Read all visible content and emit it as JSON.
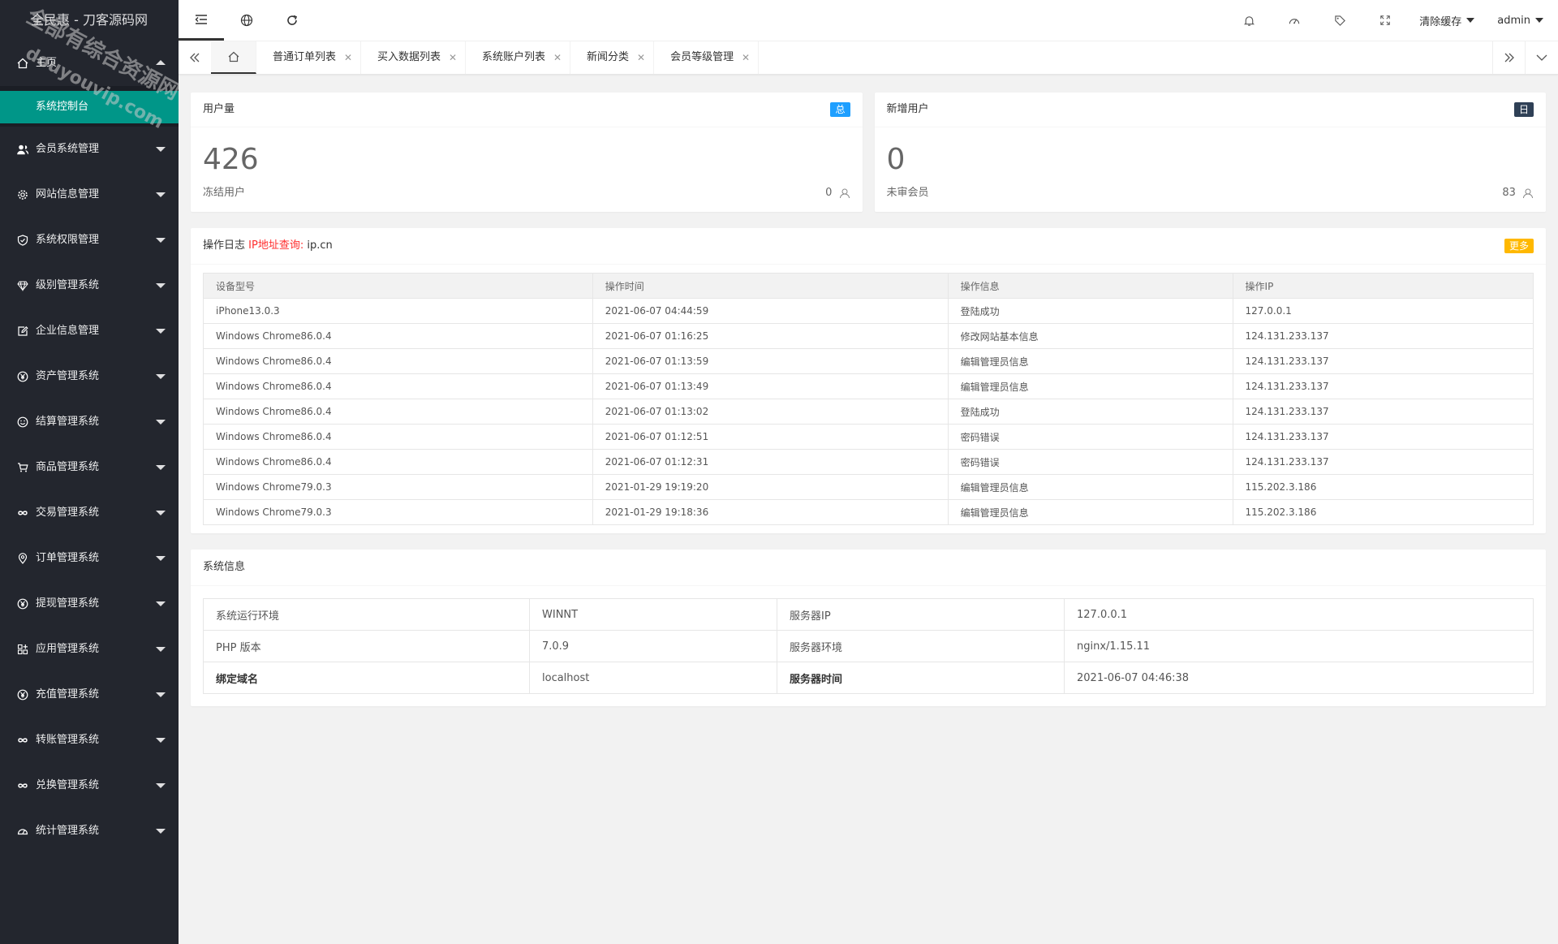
{
  "app": {
    "title": "全民惠 - 刀客源码网"
  },
  "sidebar": {
    "home_label": "主页",
    "home_sub": "系统控制台",
    "items": [
      {
        "label": "会员系统管理",
        "icon": "users-icon"
      },
      {
        "label": "网站信息管理",
        "icon": "gear-icon"
      },
      {
        "label": "系统权限管理",
        "icon": "shield-icon"
      },
      {
        "label": "级别管理系统",
        "icon": "diamond-icon"
      },
      {
        "label": "企业信息管理",
        "icon": "edit-icon"
      },
      {
        "label": "资产管理系统",
        "icon": "yen-icon"
      },
      {
        "label": "结算管理系统",
        "icon": "smile-icon"
      },
      {
        "label": "商品管理系统",
        "icon": "cart-icon"
      },
      {
        "label": "交易管理系统",
        "icon": "infinity-icon"
      },
      {
        "label": "订单管理系统",
        "icon": "location-icon"
      },
      {
        "label": "提现管理系统",
        "icon": "yen-icon"
      },
      {
        "label": "应用管理系统",
        "icon": "apps-icon"
      },
      {
        "label": "充值管理系统",
        "icon": "yen-icon"
      },
      {
        "label": "转账管理系统",
        "icon": "infinity-icon"
      },
      {
        "label": "兑换管理系统",
        "icon": "infinity-icon"
      },
      {
        "label": "统计管理系统",
        "icon": "dashboard-icon"
      }
    ]
  },
  "header": {
    "clear_cache": "清除缓存",
    "user": "admin"
  },
  "tabs": [
    "普通订单列表",
    "买入数据列表",
    "系统账户列表",
    "新闻分类",
    "会员等级管理"
  ],
  "stats": {
    "users": {
      "title": "用户量",
      "badge": "总",
      "badge_color": "#1e9fff",
      "value": "426",
      "sub_label": "冻结用户",
      "sub_value": "0"
    },
    "new_users": {
      "title": "新增用户",
      "badge": "日",
      "badge_color": "#2f4056",
      "value": "0",
      "sub_label": "未审会员",
      "sub_value": "83"
    }
  },
  "log": {
    "title": "操作日志",
    "ip_query_label": "IP地址查询:",
    "ip_query_site": "ip.cn",
    "more": "更多",
    "more_color": "#ffb800",
    "headers": [
      "设备型号",
      "操作时间",
      "操作信息",
      "操作IP"
    ],
    "rows": [
      [
        "iPhone13.0.3",
        "2021-06-07 04:44:59",
        "登陆成功",
        "127.0.0.1"
      ],
      [
        "Windows Chrome86.0.4",
        "2021-06-07 01:16:25",
        "修改网站基本信息",
        "124.131.233.137"
      ],
      [
        "Windows Chrome86.0.4",
        "2021-06-07 01:13:59",
        "编辑管理员信息",
        "124.131.233.137"
      ],
      [
        "Windows Chrome86.0.4",
        "2021-06-07 01:13:49",
        "编辑管理员信息",
        "124.131.233.137"
      ],
      [
        "Windows Chrome86.0.4",
        "2021-06-07 01:13:02",
        "登陆成功",
        "124.131.233.137"
      ],
      [
        "Windows Chrome86.0.4",
        "2021-06-07 01:12:51",
        "密码错误",
        "124.131.233.137"
      ],
      [
        "Windows Chrome86.0.4",
        "2021-06-07 01:12:31",
        "密码错误",
        "124.131.233.137"
      ],
      [
        "Windows Chrome79.0.3",
        "2021-01-29 19:19:20",
        "编辑管理员信息",
        "115.202.3.186"
      ],
      [
        "Windows Chrome79.0.3",
        "2021-01-29 19:18:36",
        "编辑管理员信息",
        "115.202.3.186"
      ]
    ]
  },
  "sysinfo": {
    "title": "系统信息",
    "rows": [
      [
        "系统运行环境",
        "WINNT",
        "服务器IP",
        "127.0.0.1"
      ],
      [
        "PHP 版本",
        "7.0.9",
        "服务器环境",
        "nginx/1.15.11"
      ],
      [
        "绑定域名",
        "localhost",
        "服务器时间",
        "2021-06-07 04:46:38"
      ]
    ]
  },
  "watermark": {
    "line1": "全部有综合资源网",
    "line2": "douyouvip.com"
  },
  "colors": {
    "sidebar_bg": "#23262e",
    "active_green": "#009688"
  }
}
